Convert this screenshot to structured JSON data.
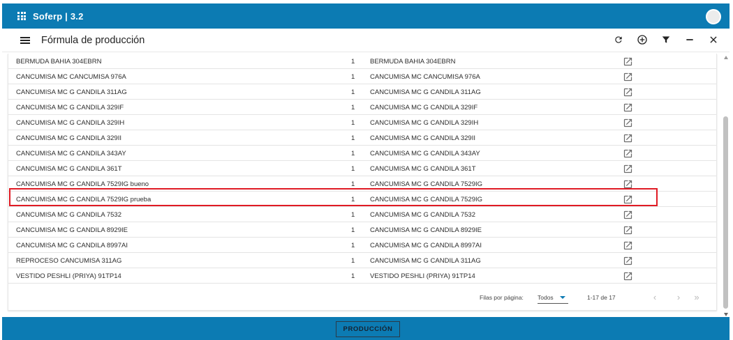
{
  "app": {
    "title": "Soferp | 3.2"
  },
  "header": {
    "title": "Fórmula de producción"
  },
  "actions": [
    "refresh-icon",
    "add-circle-icon",
    "filter-icon",
    "minimize-icon",
    "close-icon"
  ],
  "table": {
    "rows": [
      {
        "product": "BERMUDA BAHIA 304EBRN",
        "qty": "1",
        "formula": "BERMUDA BAHIA 304EBRN"
      },
      {
        "product": "CANCUMISA MC CANCUMISA 976A",
        "qty": "1",
        "formula": "CANCUMISA MC CANCUMISA 976A"
      },
      {
        "product": "CANCUMISA MC G CANDILA 311AG",
        "qty": "1",
        "formula": "CANCUMISA MC G CANDILA 311AG"
      },
      {
        "product": "CANCUMISA MC G CANDILA 329IF",
        "qty": "1",
        "formula": "CANCUMISA MC G CANDILA 329IF"
      },
      {
        "product": "CANCUMISA MC G CANDILA 329IH",
        "qty": "1",
        "formula": "CANCUMISA MC G CANDILA 329IH"
      },
      {
        "product": "CANCUMISA MC G CANDILA 329II",
        "qty": "1",
        "formula": "CANCUMISA MC G CANDILA 329II"
      },
      {
        "product": "CANCUMISA MC G CANDILA 343AY",
        "qty": "1",
        "formula": "CANCUMISA MC G CANDILA 343AY"
      },
      {
        "product": "CANCUMISA MC G CANDILA 361T",
        "qty": "1",
        "formula": "CANCUMISA MC G CANDILA 361T"
      },
      {
        "product": "CANCUMISA MC G CANDILA 7529IG bueno",
        "qty": "1",
        "formula": "CANCUMISA MC G CANDILA 7529IG"
      },
      {
        "product": "CANCUMISA MC G CANDILA 7529IG prueba",
        "qty": "1",
        "formula": "CANCUMISA MC G CANDILA 7529IG"
      },
      {
        "product": "CANCUMISA MC G CANDILA 7532",
        "qty": "1",
        "formula": "CANCUMISA MC G CANDILA 7532"
      },
      {
        "product": "CANCUMISA MC G CANDILA 8929IE",
        "qty": "1",
        "formula": "CANCUMISA MC G CANDILA 8929IE"
      },
      {
        "product": "CANCUMISA MC G CANDILA 8997AI",
        "qty": "1",
        "formula": "CANCUMISA MC G CANDILA 8997AI"
      },
      {
        "product": "REPROCESO CANCUMISA 311AG",
        "qty": "1",
        "formula": "CANCUMISA MC G CANDILA 311AG"
      },
      {
        "product": "VESTIDO PESHLI (PRIYA) 91TP14",
        "qty": "1",
        "formula": "VESTIDO PESHLI (PRIYA) 91TP14"
      }
    ],
    "highlighted_row": 9
  },
  "pagination": {
    "rows_per_page_label": "Filas por página:",
    "rows_per_page_value": "Todos",
    "range": "1-17 de 17"
  },
  "bottom": {
    "button_label": "PRODUCCIÓN"
  },
  "colors": {
    "primary": "#0c7bb3",
    "highlight": "#e01b24"
  }
}
